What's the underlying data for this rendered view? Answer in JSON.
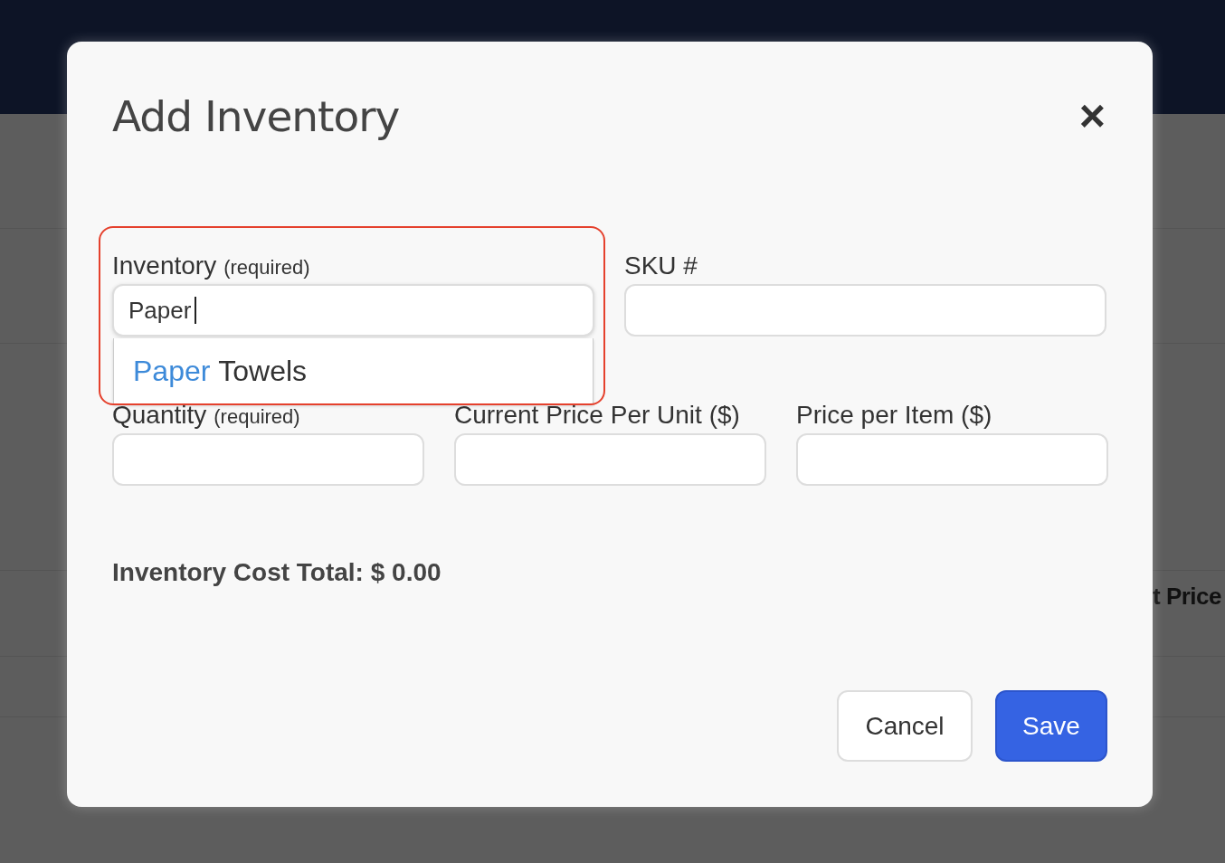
{
  "background": {
    "column_label": "t Price"
  },
  "dialog": {
    "title": "Add Inventory",
    "close_label": "×"
  },
  "fields": [
    {
      "label": "Inventory",
      "note": "(required)",
      "value": "Paper",
      "focused": true,
      "highlighted": true,
      "suggestions": [
        {
          "matched": "Paper",
          "rest": "Towels"
        }
      ]
    },
    {
      "label": "SKU #",
      "focused": false,
      "highlighted": false
    },
    {
      "label": "Quantity",
      "note": "(required)",
      "focused": false,
      "highlighted": false
    },
    {
      "label": "Current Price Per Unit ($)",
      "focused": false,
      "highlighted": false
    },
    {
      "label": "Price per Item ($)",
      "focused": false,
      "highlighted": false
    }
  ],
  "total": "Inventory Cost Total: $ 0.00",
  "buttons": [
    {
      "label": "Cancel",
      "kind": "secondary"
    },
    {
      "label": "Save",
      "kind": "primary"
    }
  ]
}
